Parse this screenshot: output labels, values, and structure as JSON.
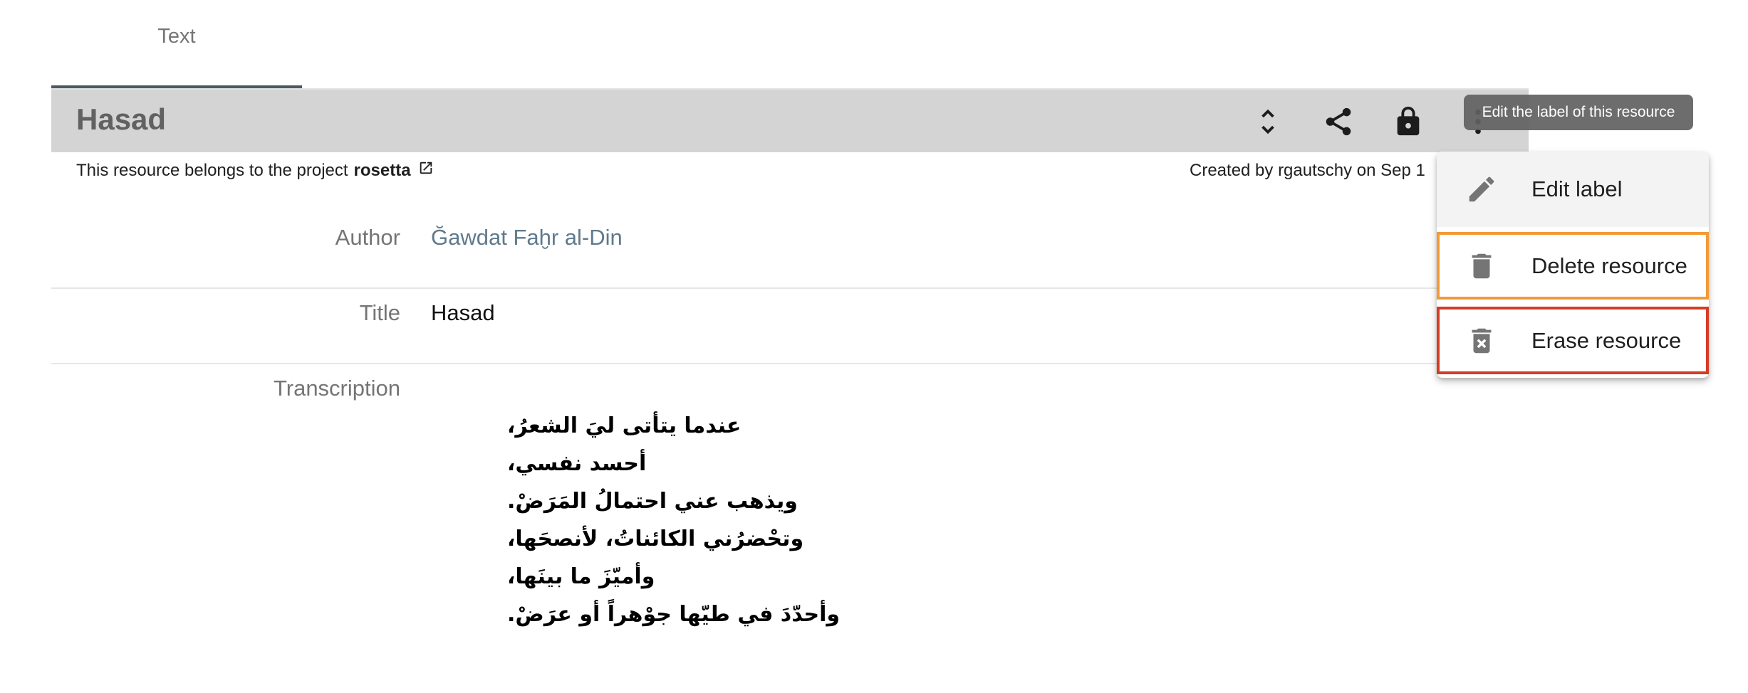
{
  "tabs": [
    {
      "label": "Text",
      "active": true
    }
  ],
  "header": {
    "title": "Hasad",
    "icons": [
      "expand-collapse-icon",
      "share-icon",
      "lock-icon",
      "more-vert-icon"
    ]
  },
  "info": {
    "project_prefix": "This resource belongs to the project",
    "project_name": "rosetta",
    "created": "Created by rgautschy on Sep 1"
  },
  "properties": [
    {
      "label": "Author",
      "value": "Ğawdat Faḫr al-Din",
      "is_link": true
    },
    {
      "label": "Title",
      "value": "Hasad",
      "is_link": false
    },
    {
      "label": "Transcription",
      "value": ""
    }
  ],
  "transcription_lines": [
    "عندما يتأتى ليَ الشعرُ،",
    "أحسد نفسي،",
    "ويذهب عني احتمالُ المَرَضْ.",
    "وتحْضرُني الكائناتُ، لأنصحَها،",
    "وأميّزَ ما بينَها،",
    "وأحدّدَ في طيّها جوْهراً أو عرَضْ."
  ],
  "tooltip": "Edit the label of this resource",
  "menu": {
    "items": [
      {
        "label": "Edit label",
        "icon": "pencil-icon"
      },
      {
        "label": "Delete resource",
        "icon": "trash-icon",
        "highlight": "#f39a37"
      },
      {
        "label": "Erase resource",
        "icon": "trash-x-icon",
        "highlight": "#d63b24"
      }
    ]
  },
  "colors": {
    "header_bg": "#d4d4d4",
    "tab_indicator": "#4a5a63",
    "link": "#5f7a8c",
    "delete_outline": "#f39a37",
    "erase_outline": "#d63b24"
  }
}
